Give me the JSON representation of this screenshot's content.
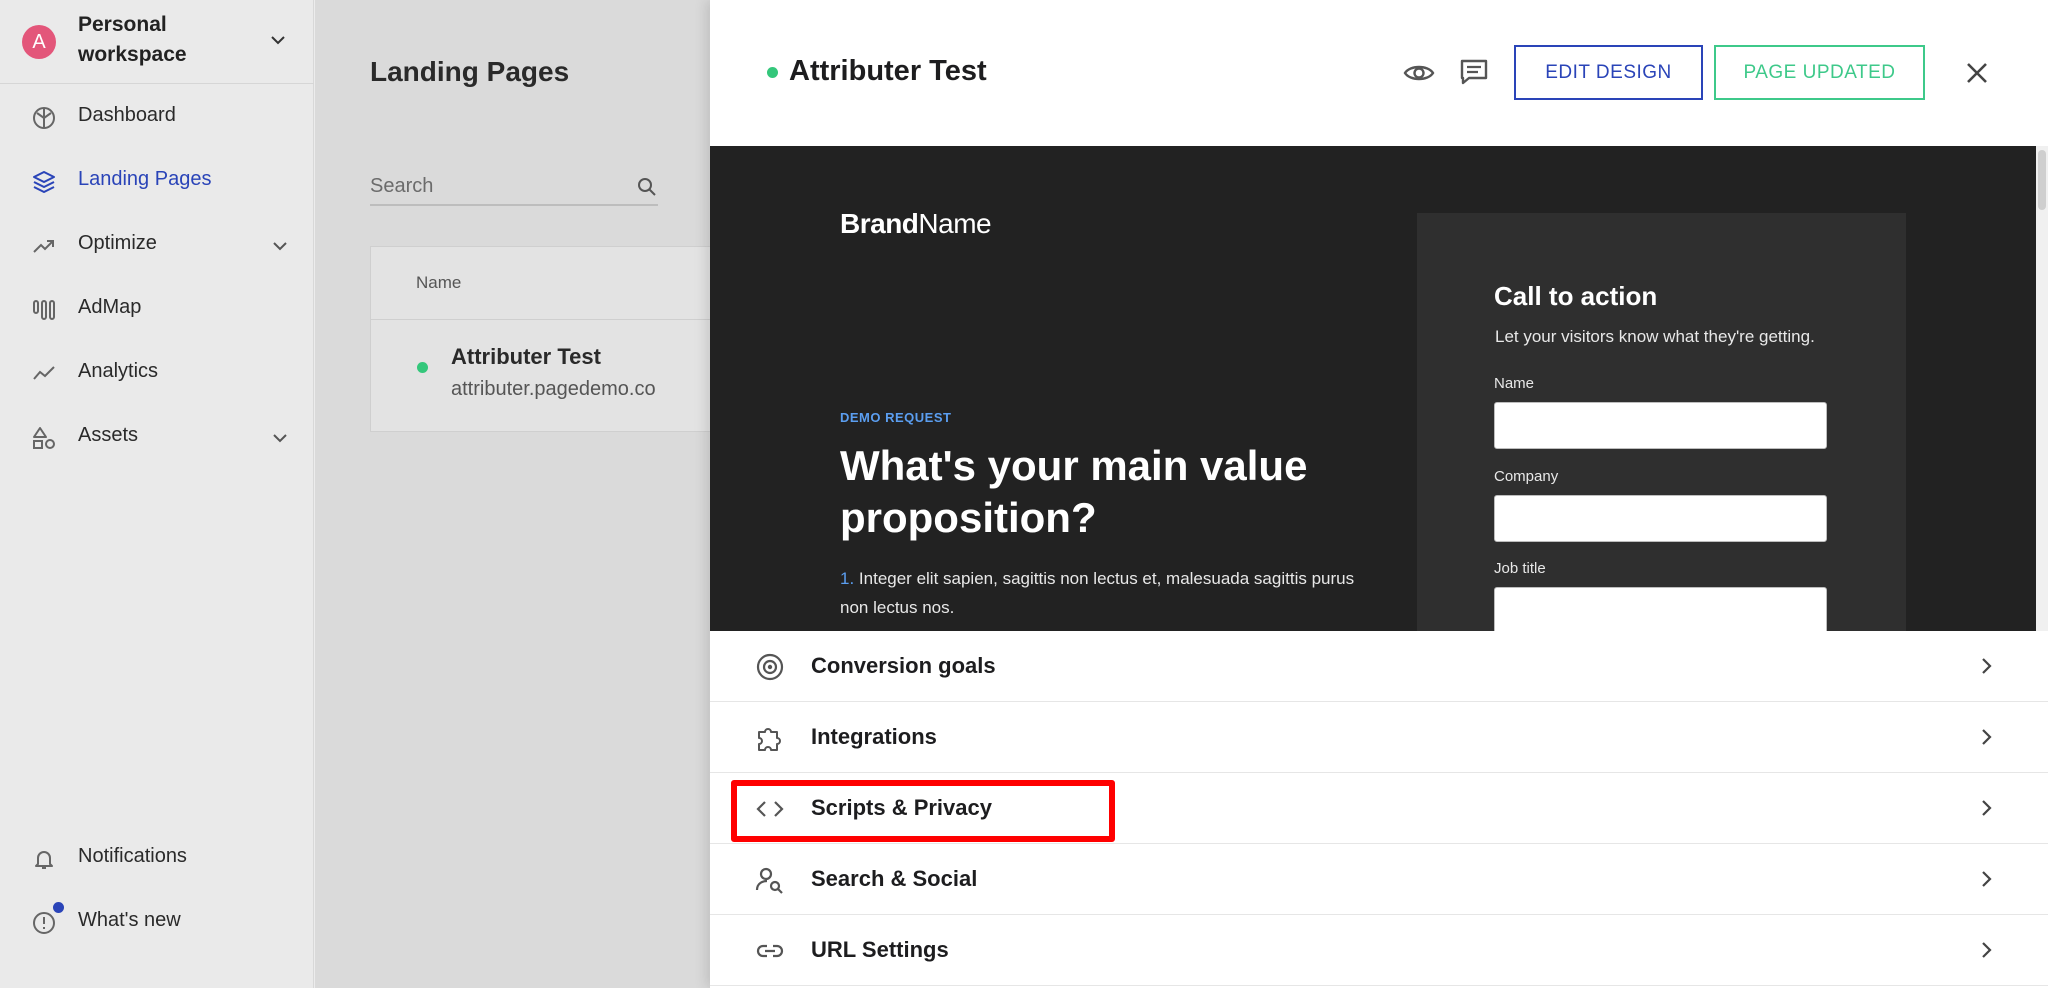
{
  "workspace": {
    "avatar_letter": "A",
    "name": "Personal workspace"
  },
  "sidebar": {
    "items": [
      {
        "label": "Dashboard"
      },
      {
        "label": "Landing Pages",
        "active": true
      },
      {
        "label": "Optimize",
        "expandable": true
      },
      {
        "label": "AdMap"
      },
      {
        "label": "Analytics"
      },
      {
        "label": "Assets",
        "expandable": true
      }
    ],
    "bottom": [
      {
        "label": "Notifications"
      },
      {
        "label": "What's new"
      }
    ]
  },
  "list": {
    "title": "Landing Pages",
    "search_placeholder": "Search",
    "column_name": "Name",
    "rows": [
      {
        "title": "Attributer Test",
        "url": "attributer.pagedemo.co",
        "status": "live"
      }
    ]
  },
  "drawer": {
    "title": "Attributer Test",
    "edit_button": "EDIT DESIGN",
    "status_button": "PAGE UPDATED",
    "preview": {
      "brand_bold": "Brand",
      "brand_regular": "Name",
      "demo_label": "DEMO REQUEST",
      "headline": "What's your main value proposition?",
      "body_number": "1.",
      "body_text": "Integer elit sapien, sagittis non lectus et, malesuada sagittis purus non lectus nos.",
      "form": {
        "title": "Call to action",
        "subtitle": "Let your visitors know what they're getting.",
        "fields": [
          "Name",
          "Company",
          "Job title"
        ]
      }
    },
    "settings": [
      {
        "label": "Conversion goals",
        "icon": "target-icon"
      },
      {
        "label": "Integrations",
        "icon": "puzzle-icon"
      },
      {
        "label": "Scripts & Privacy",
        "icon": "code-icon",
        "highlighted": true
      },
      {
        "label": "Search & Social",
        "icon": "user-search-icon"
      },
      {
        "label": "URL Settings",
        "icon": "link-icon"
      }
    ]
  },
  "colors": {
    "accent": "#2a44b8",
    "success": "#3ec98a",
    "highlight": "#ff0000",
    "preview_bg": "#222222"
  }
}
